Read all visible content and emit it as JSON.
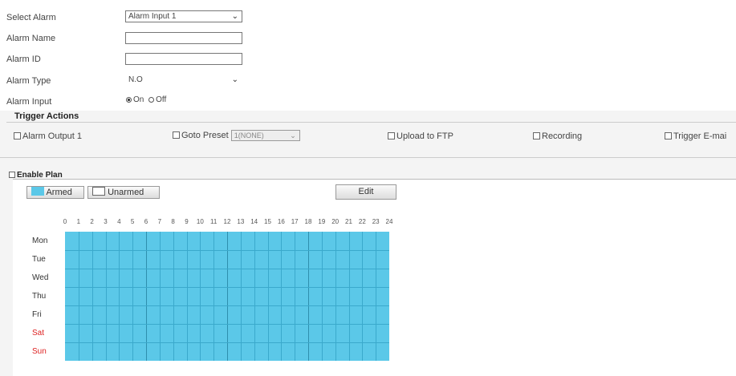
{
  "form": {
    "select_alarm": {
      "label": "Select Alarm",
      "value": "Alarm Input 1"
    },
    "alarm_name": {
      "label": "Alarm Name",
      "value": ""
    },
    "alarm_id": {
      "label": "Alarm ID",
      "value": ""
    },
    "alarm_type": {
      "label": "Alarm Type",
      "value": "N.O"
    },
    "alarm_input": {
      "label": "Alarm Input",
      "on_label": "On",
      "off_label": "Off",
      "selected": "On"
    }
  },
  "trigger": {
    "title": "Trigger Actions",
    "alarm_output": "Alarm Output 1",
    "goto_preset": "Goto Preset",
    "preset_value": "1(NONE)",
    "upload_ftp": "Upload to FTP",
    "recording": "Recording",
    "trigger_email": "Trigger E-mai"
  },
  "plan": {
    "title": "Enable Plan",
    "armed": "Armed",
    "unarmed": "Unarmed",
    "edit": "Edit",
    "armed_color": "#5bc8e8",
    "hours": [
      "0",
      "1",
      "2",
      "3",
      "4",
      "5",
      "6",
      "7",
      "8",
      "9",
      "10",
      "11",
      "12",
      "13",
      "14",
      "15",
      "16",
      "17",
      "18",
      "19",
      "20",
      "21",
      "22",
      "23",
      "24"
    ],
    "days": [
      "Mon",
      "Tue",
      "Wed",
      "Thu",
      "Fri",
      "Sat",
      "Sun"
    ],
    "weekend_color": "#dd2222"
  }
}
